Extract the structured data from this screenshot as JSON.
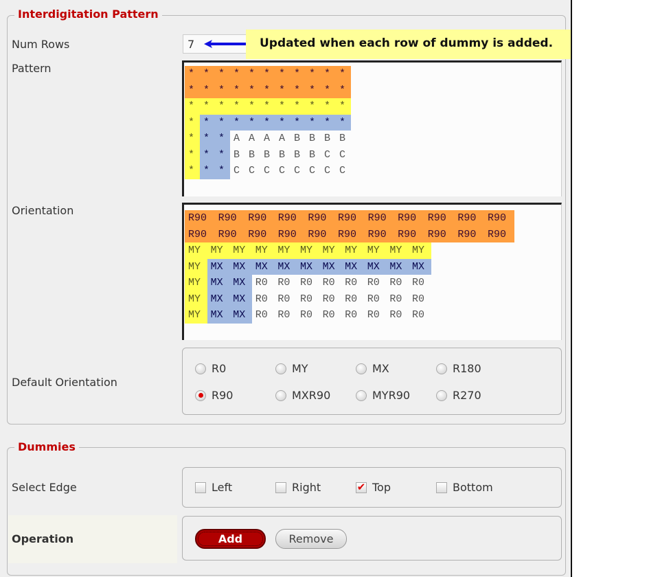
{
  "interdigitation": {
    "legend": "Interdigitation Pattern",
    "num_rows_label": "Num Rows",
    "num_rows_value": "7",
    "tooltip": "Updated when each row of dummy is added.",
    "pattern_label": "Pattern",
    "pattern_rows": [
      {
        "cells": [
          "*",
          "*",
          "*",
          "*",
          "*",
          "*",
          "*",
          "*",
          "*",
          "*",
          "*"
        ],
        "bg": "ooooooooooo"
      },
      {
        "cells": [
          "*",
          "*",
          "*",
          "*",
          "*",
          "*",
          "*",
          "*",
          "*",
          "*",
          "*"
        ],
        "bg": "ooooooooooo"
      },
      {
        "cells": [
          "*",
          "*",
          "*",
          "*",
          "*",
          "*",
          "*",
          "*",
          "*",
          "*",
          "*"
        ],
        "bg": "yyyyyyyyyyy"
      },
      {
        "cells": [
          "*",
          "*",
          "*",
          "*",
          "*",
          "*",
          "*",
          "*",
          "*",
          "*",
          "*"
        ],
        "bg": "ybbbbbbbbbb"
      },
      {
        "cells": [
          "*",
          "*",
          "*",
          "A",
          "A",
          "A",
          "A",
          "B",
          "B",
          "B",
          "B"
        ],
        "bg": "ybbwwwwwwww"
      },
      {
        "cells": [
          "*",
          "*",
          "*",
          "B",
          "B",
          "B",
          "B",
          "B",
          "B",
          "C",
          "C"
        ],
        "bg": "ybbwwwwwwww"
      },
      {
        "cells": [
          "*",
          "*",
          "*",
          "C",
          "C",
          "C",
          "C",
          "C",
          "C",
          "C",
          "C"
        ],
        "bg": "ybbwwwwwwww"
      }
    ],
    "orientation_label": "Orientation",
    "orientation_rows": [
      {
        "cells": [
          "R90",
          "R90",
          "R90",
          "R90",
          "R90",
          "R90",
          "R90",
          "R90",
          "R90",
          "R90",
          "R90"
        ],
        "bg": "ooooooooooo"
      },
      {
        "cells": [
          "R90",
          "R90",
          "R90",
          "R90",
          "R90",
          "R90",
          "R90",
          "R90",
          "R90",
          "R90",
          "R90"
        ],
        "bg": "ooooooooooo"
      },
      {
        "cells": [
          "MY",
          "MY",
          "MY",
          "MY",
          "MY",
          "MY",
          "MY",
          "MY",
          "MY",
          "MY",
          "MY"
        ],
        "bg": "yyyyyyyyyyy"
      },
      {
        "cells": [
          "MY",
          "MX",
          "MX",
          "MX",
          "MX",
          "MX",
          "MX",
          "MX",
          "MX",
          "MX",
          "MX"
        ],
        "bg": "ybbbbbbbbbb"
      },
      {
        "cells": [
          "MY",
          "MX",
          "MX",
          "R0",
          "R0",
          "R0",
          "R0",
          "R0",
          "R0",
          "R0",
          "R0"
        ],
        "bg": "ybbwwwwwwww"
      },
      {
        "cells": [
          "MY",
          "MX",
          "MX",
          "R0",
          "R0",
          "R0",
          "R0",
          "R0",
          "R0",
          "R0",
          "R0"
        ],
        "bg": "ybbwwwwwwww"
      },
      {
        "cells": [
          "MY",
          "MX",
          "MX",
          "R0",
          "R0",
          "R0",
          "R0",
          "R0",
          "R0",
          "R0",
          "R0"
        ],
        "bg": "ybbwwwwwwww"
      }
    ],
    "default_orientation_label": "Default Orientation",
    "default_orientation_options": [
      "R0",
      "MY",
      "MX",
      "R180",
      "R90",
      "MXR90",
      "MYR90",
      "R270"
    ],
    "default_orientation_selected": "R90"
  },
  "dummies": {
    "legend": "Dummies",
    "select_edge_label": "Select Edge",
    "edges": [
      {
        "label": "Left",
        "checked": false
      },
      {
        "label": "Right",
        "checked": false
      },
      {
        "label": "Top",
        "checked": true
      },
      {
        "label": "Bottom",
        "checked": false
      }
    ],
    "operation_label": "Operation",
    "add_label": "Add",
    "remove_label": "Remove"
  },
  "colors": {
    "orange": "#ff9f40",
    "yellow": "#ffff50",
    "blue": "#a0b8e0",
    "accent": "#c00000"
  }
}
